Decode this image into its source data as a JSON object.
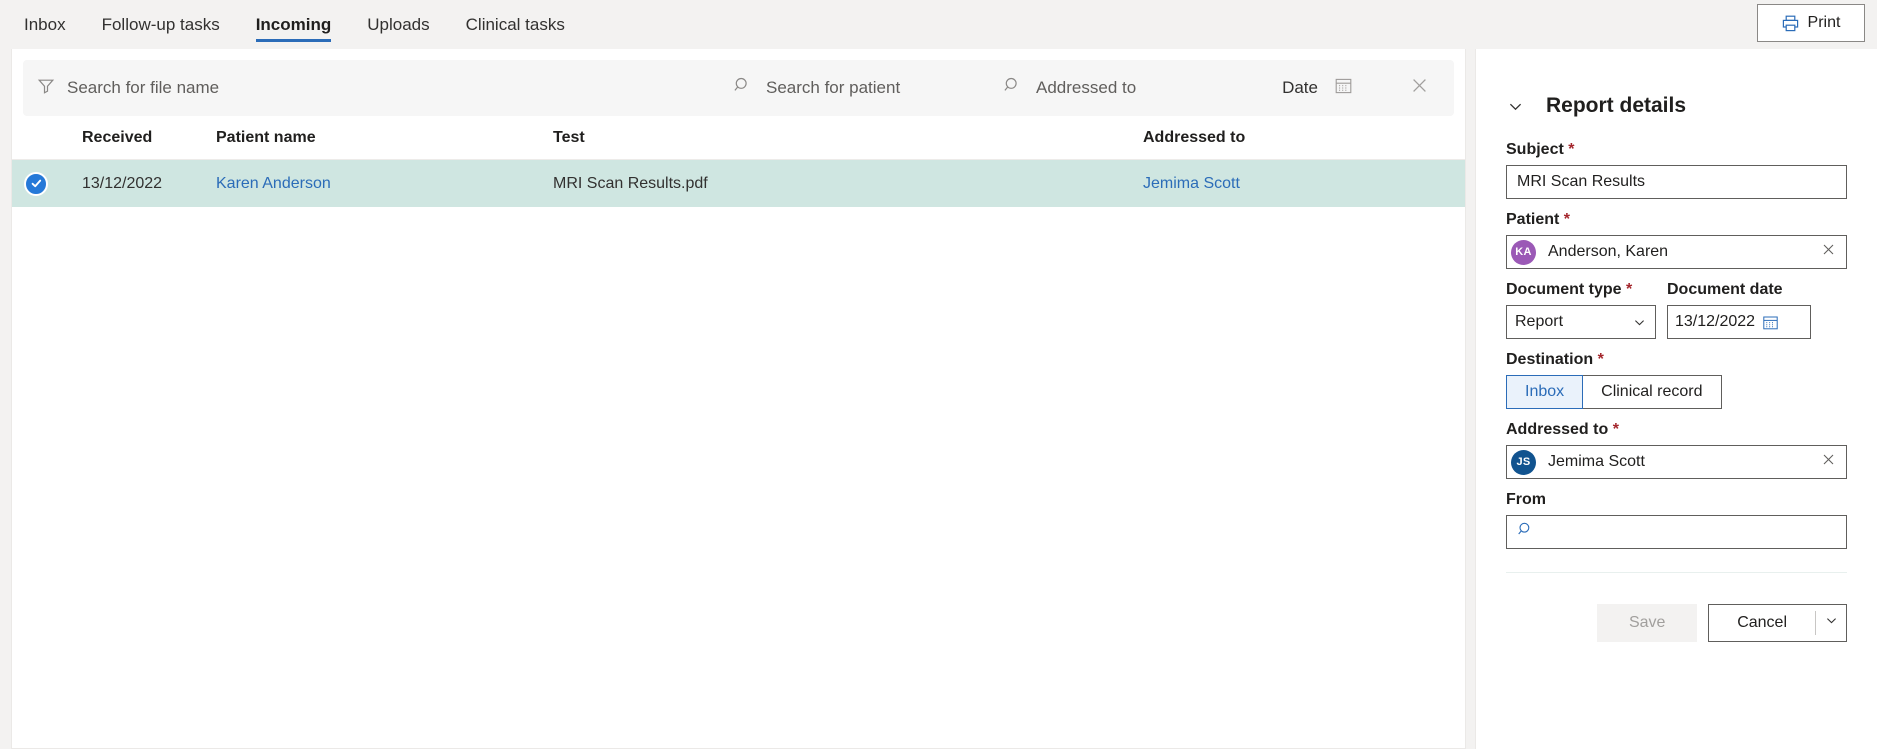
{
  "topbar": {
    "tabs": [
      {
        "label": "Inbox",
        "active": false
      },
      {
        "label": "Follow-up tasks",
        "active": false
      },
      {
        "label": "Incoming",
        "active": true
      },
      {
        "label": "Uploads",
        "active": false
      },
      {
        "label": "Clinical tasks",
        "active": false
      }
    ],
    "print_label": "Print",
    "print_icon": "printer-icon"
  },
  "filterbar": {
    "file_placeholder": "Search for file name",
    "file_icon": "filter-funnel-icon",
    "patient_placeholder": "Search for patient",
    "patient_icon": "search-icon",
    "addressed_placeholder": "Addressed to",
    "addressed_icon": "search-icon",
    "date_label": "Date",
    "date_icon": "calendar-icon",
    "clear_icon": "close-icon"
  },
  "table": {
    "columns": [
      "Received",
      "Patient name",
      "Test",
      "Addressed to"
    ],
    "rows": [
      {
        "selected": true,
        "select_icon": "check-circle-icon",
        "received": "13/12/2022",
        "patient_name": "Karen Anderson",
        "test": "MRI Scan Results.pdf",
        "addressed_to": "Jemima Scott"
      }
    ]
  },
  "panel": {
    "title": "Report details",
    "collapse_icon": "chevron-down-icon",
    "subject": {
      "label": "Subject",
      "required": "*",
      "value": "MRI Scan Results"
    },
    "patient": {
      "label": "Patient",
      "required": "*",
      "value": "Anderson, Karen",
      "initials": "KA",
      "avatar_color": "#9b59b6",
      "clear_icon": "close-icon"
    },
    "document_type": {
      "label": "Document type",
      "required": "*",
      "value": "Report",
      "caret_icon": "chevron-down-icon"
    },
    "document_date": {
      "label": "Document date",
      "value": "13/12/2022",
      "calendar_icon": "calendar-icon"
    },
    "destination": {
      "label": "Destination",
      "required": "*",
      "options": [
        "Inbox",
        "Clinical record"
      ],
      "selected": "Inbox"
    },
    "addressed_to": {
      "label": "Addressed to",
      "required": "*",
      "value": "Jemima Scott",
      "initials": "JS",
      "avatar_color": "#11538f",
      "clear_icon": "close-icon"
    },
    "from": {
      "label": "From",
      "value": "",
      "placeholder": "",
      "search_icon": "search-icon"
    },
    "actions": {
      "save_label": "Save",
      "cancel_label": "Cancel",
      "cancel_caret_icon": "chevron-down-icon"
    }
  }
}
